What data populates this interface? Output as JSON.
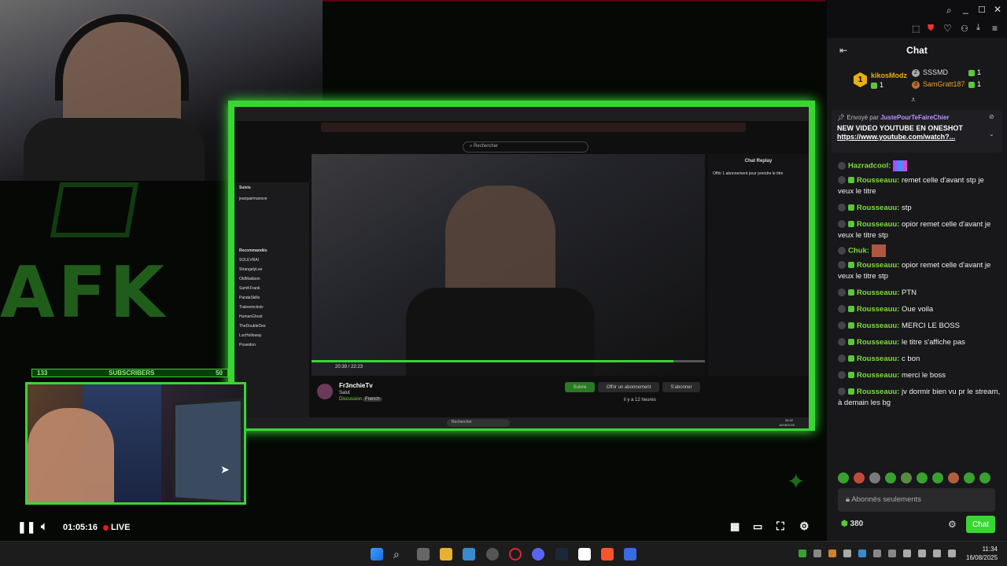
{
  "player": {
    "time": "01:05:16",
    "live": "LIVE",
    "bar_left": "133",
    "bar_mid": "SUBSCRIBERS",
    "bar_right": "50"
  },
  "inner_browser": {
    "search_placeholder": "Rechercher",
    "chat_replay_title": "Chat Replay",
    "chat_replay_msg": "Offrir 1 abonnement pour prendre le titre",
    "sidebar_followed": "Suivis",
    "sidebar_recommended": "Recommandés",
    "video_time": "20:39 / 22:23",
    "streamer_name": "Fr3nchieTv",
    "stream_title": "Salut",
    "stream_category": "Discussion",
    "stream_tag": "French",
    "follow_btn": "Suivre",
    "gift_btn": "Offrir un abonnement",
    "sub_btn": "S'abonner",
    "views": "il y a 12 heures",
    "inner_clock_time": "08:42",
    "inner_clock_date": "16/08/2025",
    "sidebar_items": [
      "jeanpairmanove",
      "SOLEVRAI",
      "StrangelyLee",
      "OldMadison",
      "SamKFrank",
      "PandaSkills",
      "Trainwreckstv",
      "HumanGhost",
      "TheDoubleDee",
      "LucHolloway",
      "Poseidon"
    ]
  },
  "chat": {
    "title": "Chat",
    "leaderboard": [
      {
        "rank": "1",
        "name": "kikosModz",
        "count": "1"
      },
      {
        "rank": "2",
        "name": "SSSMD",
        "count": "1"
      },
      {
        "rank": "3",
        "name": "SamGratt187",
        "count": "1"
      }
    ],
    "pinned": {
      "sent_by_label": "Envoyé par",
      "sent_by_user": "JustePourTeFaireChier",
      "title": "NEW VIDEO YOUTUBE EN ONESHOT",
      "link": "https://www.youtube.com/watch?..."
    },
    "messages": [
      {
        "user": "Hazradcool:",
        "text": ""
      },
      {
        "user": "Rousseauu:",
        "text": " remet celle d'avant stp je veux le titre"
      },
      {
        "user": "Rousseauu:",
        "text": " stp"
      },
      {
        "user": "Rousseauu:",
        "text": " opior remet celle d'avant je veux le titre stp"
      },
      {
        "user": "Chuk:",
        "text": ""
      },
      {
        "user": "Rousseauu:",
        "text": " opior remet celle d'avant je veux le titre stp"
      },
      {
        "user": "Rousseauu:",
        "text": " PTN"
      },
      {
        "user": "Rousseauu:",
        "text": " Oue voila"
      },
      {
        "user": "Rousseauu:",
        "text": " MERCI LE BOSS"
      },
      {
        "user": "Rousseauu:",
        "text": " le titre s'affiche pas"
      },
      {
        "user": "Rousseauu:",
        "text": " c bon"
      },
      {
        "user": "Rousseauu:",
        "text": " merci le boss"
      },
      {
        "user": "Rousseauu:",
        "text": " jv dormir bien vu pr le stream, à demain les bg"
      }
    ],
    "input_placeholder": "Abonnés seulements",
    "points": "380",
    "send_label": "Chat"
  },
  "taskbar": {
    "time": "11:34",
    "date": "16/08/2025"
  },
  "colors": {
    "accent_green": "#39d633",
    "chat_bg": "#18181b",
    "user_green": "#7ddc3b",
    "pinned_user": "#bf94ff"
  }
}
